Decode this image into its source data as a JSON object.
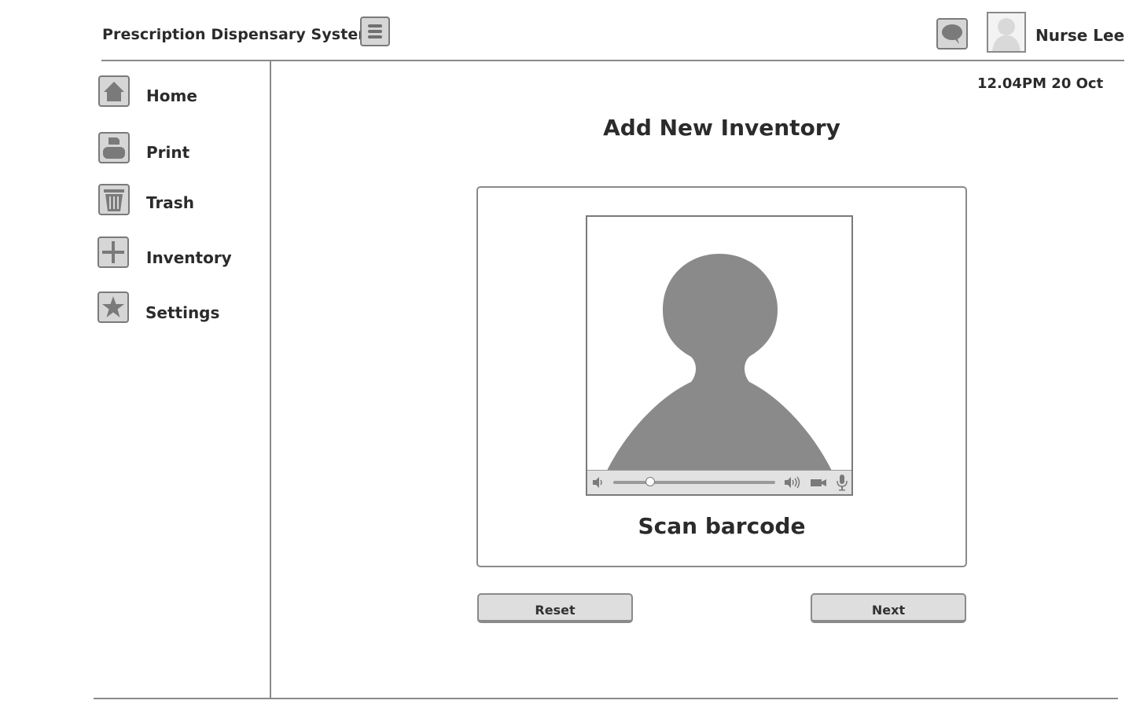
{
  "header": {
    "app_title": "Prescription Dispensary System",
    "user_name": "Nurse Lee",
    "menu_icon": "hamburger-menu-icon",
    "chat_icon": "speech-bubble-icon",
    "avatar_icon": "user-avatar-icon"
  },
  "sidebar": {
    "items": [
      {
        "label": "Home",
        "icon": "home-icon"
      },
      {
        "label": "Print",
        "icon": "printer-icon"
      },
      {
        "label": "Trash",
        "icon": "trash-icon"
      },
      {
        "label": "Inventory",
        "icon": "plus-icon"
      },
      {
        "label": "Settings",
        "icon": "star-icon"
      }
    ]
  },
  "main": {
    "datetime": "12.04PM 20 Oct",
    "title": "Add New Inventory",
    "scan_label": "Scan barcode",
    "video_icons": [
      "volume-low-icon",
      "progress-slider",
      "volume-high-icon",
      "camera-icon",
      "microphone-icon"
    ],
    "video_progress": 0.23,
    "buttons": {
      "reset": "Reset",
      "next": "Next"
    }
  },
  "colors": {
    "line": "#8a8a8a",
    "icon_fill": "#7a7a7a",
    "button_bg": "#dedede",
    "placeholder": "#8a8a8a"
  }
}
